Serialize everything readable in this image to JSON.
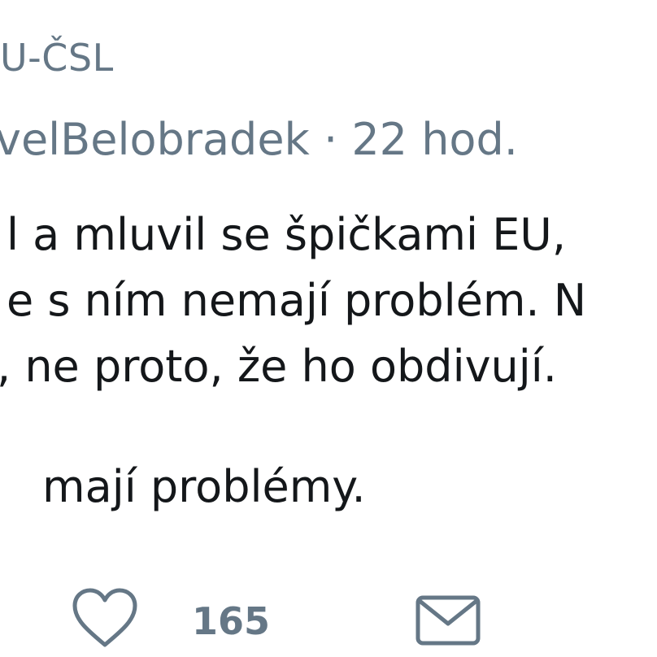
{
  "tweet": {
    "handle_line": "U-ČSL",
    "meta_line": "velBelobradek · 22 hod.",
    "text_lines": [
      "l a mluvil se špičkami EU, ",
      "e s ním nemají problém. N",
      ", ne proto, že ho obdivují.",
      "mají problémy."
    ]
  },
  "actions": {
    "like_icon": "heart-icon",
    "like_count": "165",
    "message_icon": "envelope-icon"
  },
  "colors": {
    "secondary_text": "#657786",
    "primary_text": "#14171a"
  }
}
